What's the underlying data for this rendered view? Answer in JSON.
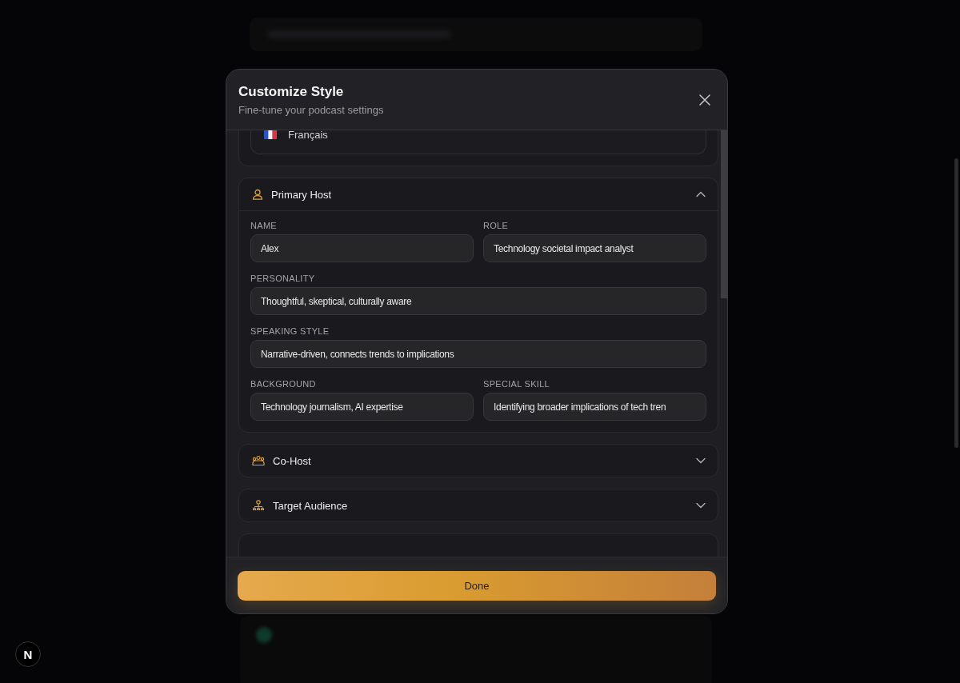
{
  "dialog": {
    "title": "Customize Style",
    "subtitle": "Fine-tune your podcast settings"
  },
  "language_option": {
    "label": "Français"
  },
  "sections": [
    {
      "title": "Primary Host",
      "kind": "person",
      "expanded": true,
      "rows": [
        [
          {
            "label": "NAME",
            "value": "Alex"
          },
          {
            "label": "ROLE",
            "value": "Technology societal impact analyst"
          }
        ],
        [
          {
            "label": "PERSONALITY",
            "value": "Thoughtful, skeptical, culturally aware"
          }
        ],
        [
          {
            "label": "SPEAKING STYLE",
            "value": "Narrative-driven, connects trends to implications"
          }
        ],
        [
          {
            "label": "BACKGROUND",
            "value": "Technology journalism, AI expertise"
          },
          {
            "label": "SPECIAL SKILL",
            "value": "Identifying broader implications of tech tren"
          }
        ]
      ]
    },
    {
      "title": "Co-Host",
      "kind": "group",
      "expanded": false
    },
    {
      "title": "Target Audience",
      "kind": "audience",
      "expanded": false
    }
  ],
  "done_button": "Done",
  "badge": "N"
}
